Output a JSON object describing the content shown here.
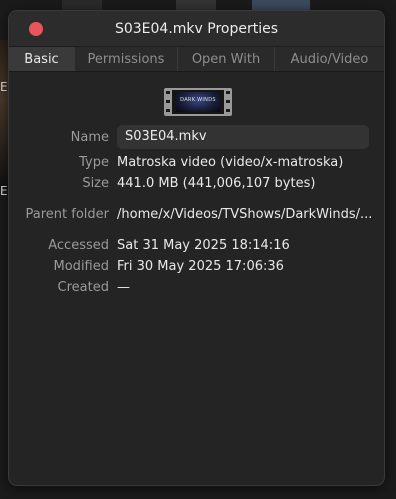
{
  "window": {
    "title": "S03E04.mkv Properties"
  },
  "tabs": [
    {
      "label": "Basic",
      "active": true
    },
    {
      "label": "Permissions",
      "active": false
    },
    {
      "label": "Open With",
      "active": false
    },
    {
      "label": "Audio/Video",
      "active": false
    }
  ],
  "thumbnail": {
    "caption": "DARK WINDS"
  },
  "fields": {
    "name_label": "Name",
    "name_value": "S03E04.mkv",
    "type_label": "Type",
    "type_value": "Matroska video (video/x-matroska)",
    "size_label": "Size",
    "size_value": "441.0 MB (441,006,107 bytes)",
    "parent_label": "Parent folder",
    "parent_value": "/home/x/Videos/TVShows/DarkWinds/...",
    "accessed_label": "Accessed",
    "accessed_value": "Sat 31 May 2025 18:14:16",
    "modified_label": "Modified",
    "modified_value": "Fri 30 May 2025 17:06:36",
    "created_label": "Created",
    "created_value": "—"
  },
  "background": {
    "fragment_1": "E",
    "fragment_2": "E"
  },
  "colors": {
    "close_button": "#e9555b",
    "window_bg": "#242424",
    "titlebar_bg": "#2c2c2c",
    "active_tab_bg": "#3a3a3a"
  }
}
